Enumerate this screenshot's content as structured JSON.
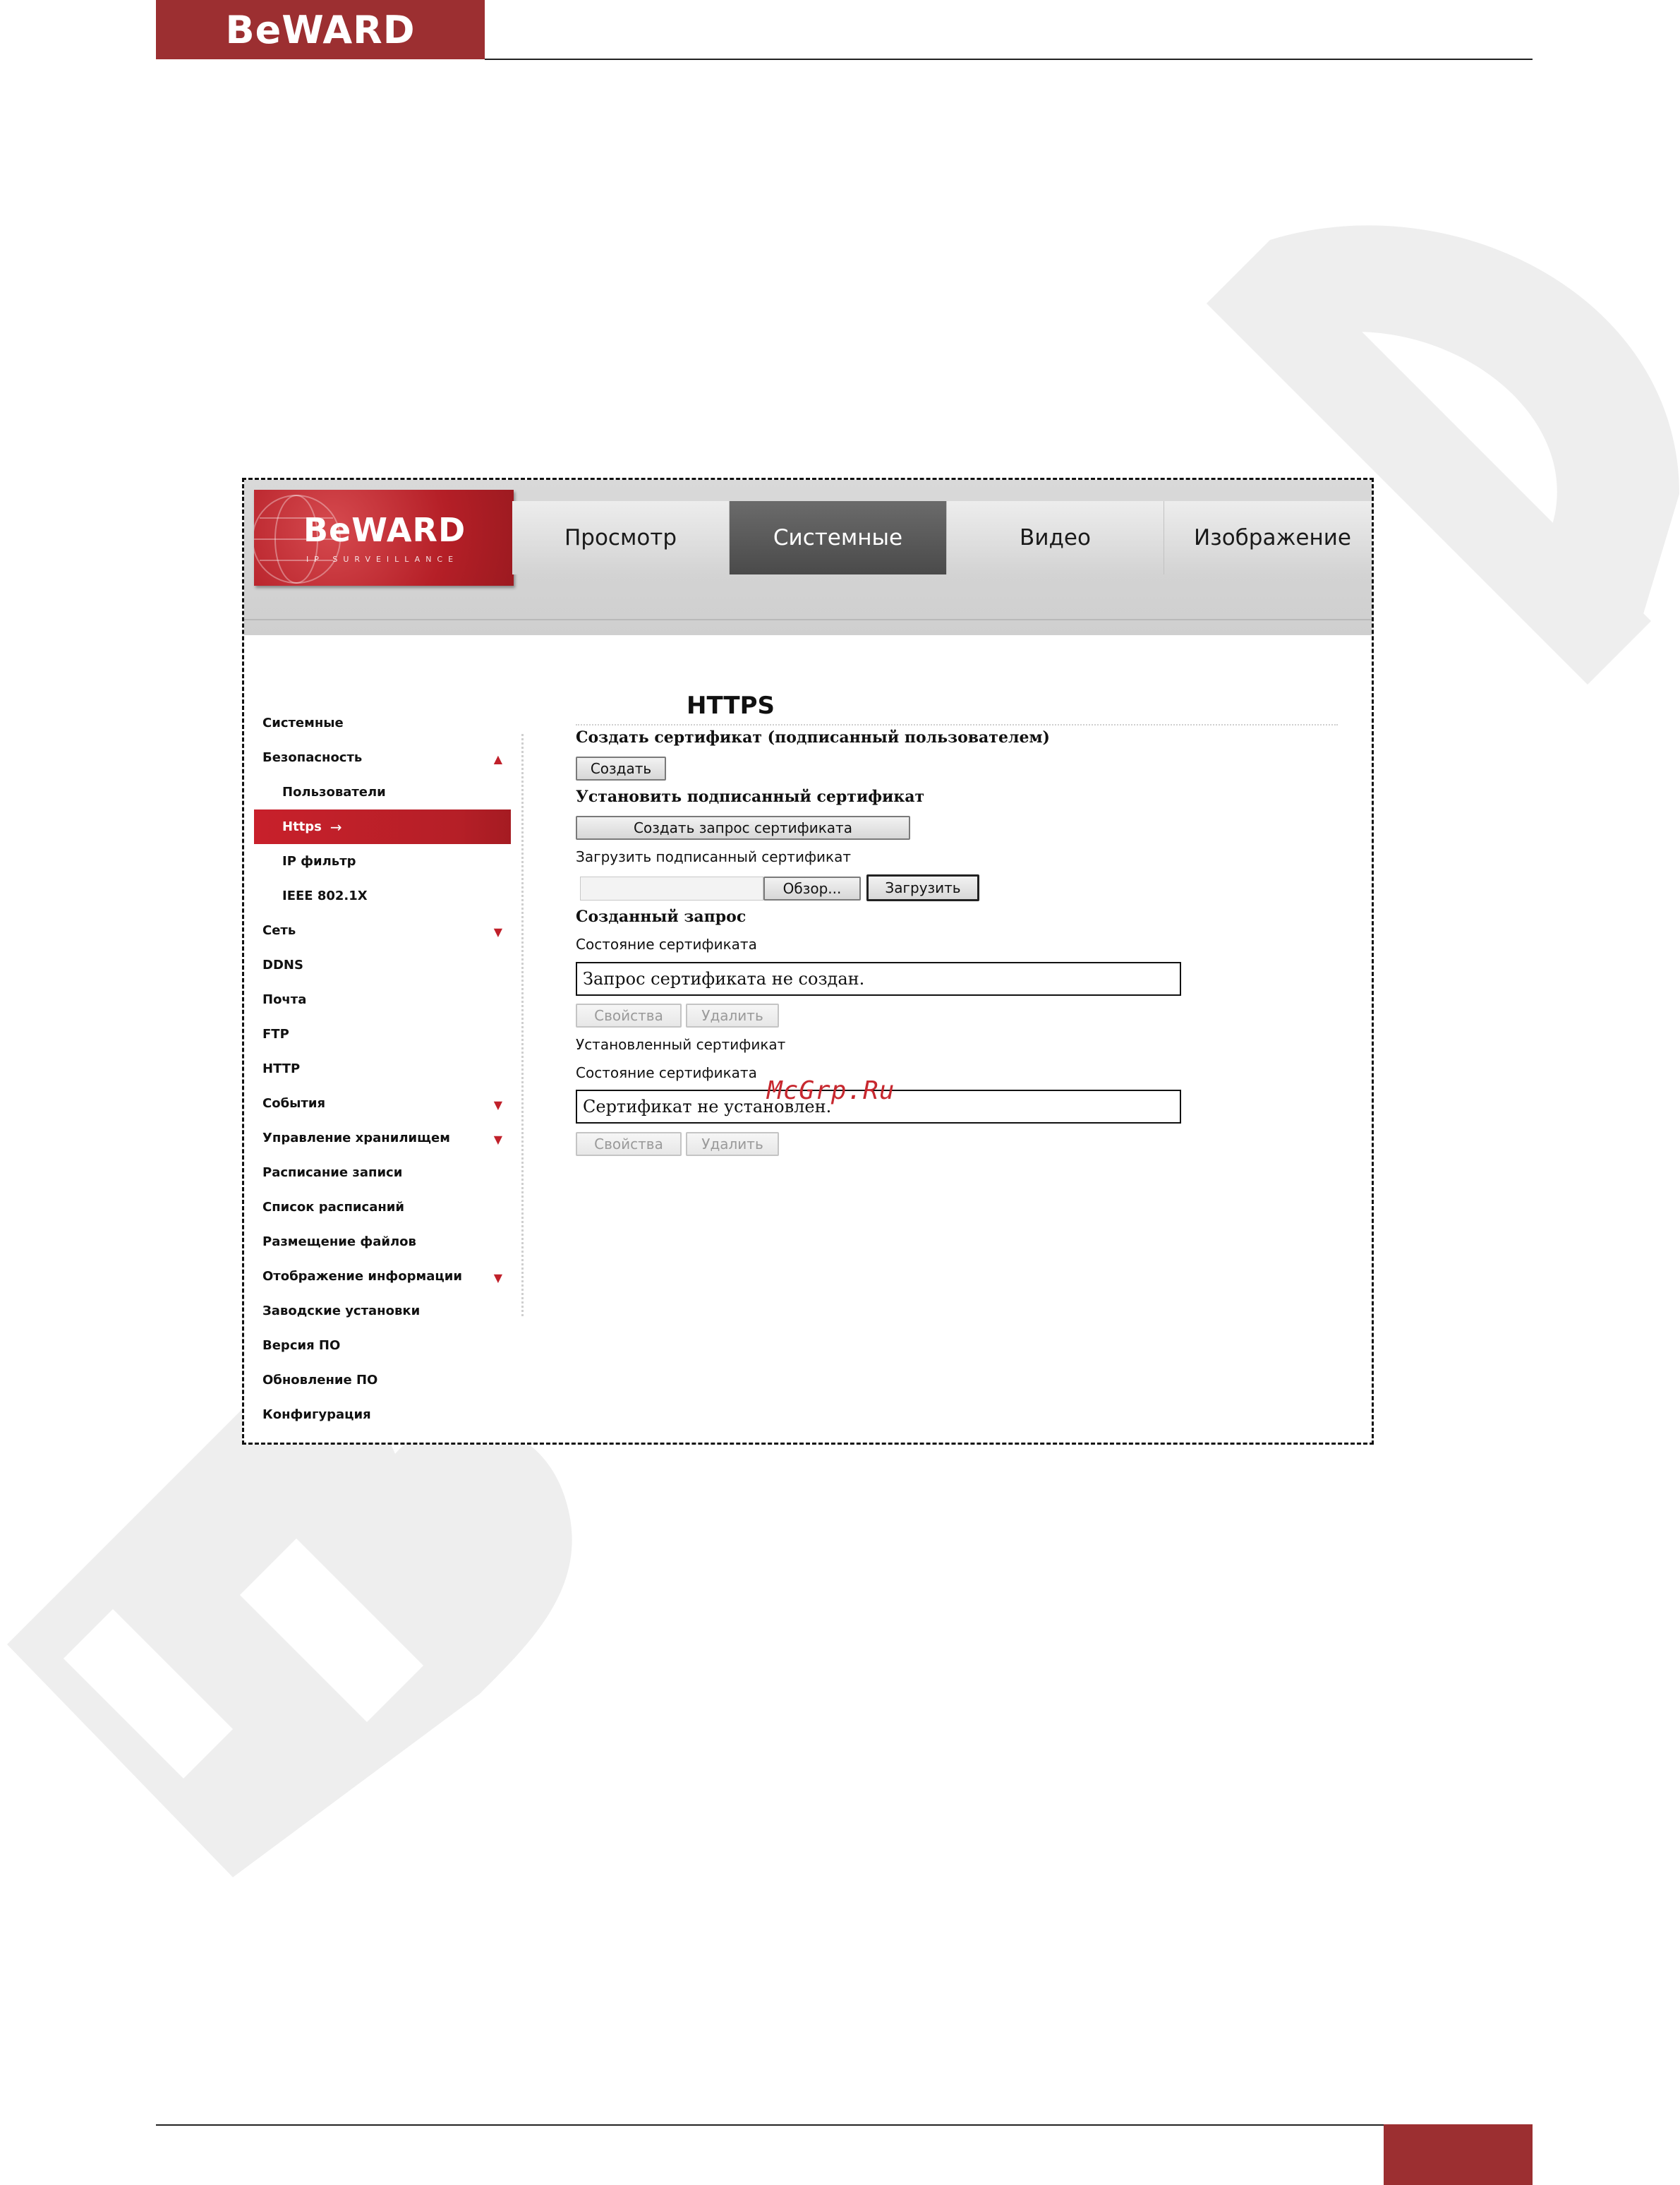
{
  "document": {
    "header_logo": "BeWARD",
    "watermark": "BeWARD"
  },
  "app": {
    "logo": {
      "brand": "BeWARD",
      "tagline": "IP SURVEILLANCE"
    },
    "tabs": [
      {
        "label": "Просмотр",
        "active": false
      },
      {
        "label": "Системные",
        "active": true
      },
      {
        "label": "Видео",
        "active": false
      },
      {
        "label": "Изображение",
        "active": false
      }
    ],
    "sidebar": {
      "items": [
        {
          "label": "Системные",
          "sub": false,
          "active": false,
          "arrow": ""
        },
        {
          "label": "Безопасность",
          "sub": false,
          "active": false,
          "arrow": "▲"
        },
        {
          "label": "Пользователи",
          "sub": true,
          "active": false,
          "arrow": ""
        },
        {
          "label": "Https",
          "sub": true,
          "active": true,
          "arrow": "",
          "pointer": "→"
        },
        {
          "label": "IP фильтр",
          "sub": true,
          "active": false,
          "arrow": ""
        },
        {
          "label": "IEEE 802.1X",
          "sub": true,
          "active": false,
          "arrow": ""
        },
        {
          "label": "Сеть",
          "sub": false,
          "active": false,
          "arrow": "▼"
        },
        {
          "label": "DDNS",
          "sub": false,
          "active": false,
          "arrow": ""
        },
        {
          "label": "Почта",
          "sub": false,
          "active": false,
          "arrow": ""
        },
        {
          "label": "FTP",
          "sub": false,
          "active": false,
          "arrow": ""
        },
        {
          "label": "HTTP",
          "sub": false,
          "active": false,
          "arrow": ""
        },
        {
          "label": "События",
          "sub": false,
          "active": false,
          "arrow": "▼"
        },
        {
          "label": "Управление хранилищем",
          "sub": false,
          "active": false,
          "arrow": "▼"
        },
        {
          "label": "Расписание записи",
          "sub": false,
          "active": false,
          "arrow": ""
        },
        {
          "label": "Список расписаний",
          "sub": false,
          "active": false,
          "arrow": ""
        },
        {
          "label": "Размещение файлов",
          "sub": false,
          "active": false,
          "arrow": ""
        },
        {
          "label": "Отображение информации",
          "sub": false,
          "active": false,
          "arrow": "▼"
        },
        {
          "label": "Заводские установки",
          "sub": false,
          "active": false,
          "arrow": ""
        },
        {
          "label": "Версия ПО",
          "sub": false,
          "active": false,
          "arrow": ""
        },
        {
          "label": "Обновление ПО",
          "sub": false,
          "active": false,
          "arrow": ""
        },
        {
          "label": "Конфигурация",
          "sub": false,
          "active": false,
          "arrow": ""
        }
      ]
    },
    "content": {
      "title": "HTTPS",
      "create_cert_heading": "Создать сертификат (подписанный пользователем)",
      "create_button": "Создать",
      "install_heading": "Установить подписанный сертификат",
      "request_button": "Создать запрос сертификата",
      "upload_label": "Загрузить подписанный сертификат",
      "browse_button": "Обзор...",
      "upload_button": "Загрузить",
      "created_request_heading": "Созданный запрос",
      "cert_state_label_1": "Состояние сертификата",
      "cert_state_value_1": "Запрос сертификата не создан.",
      "properties_button_1": "Свойства",
      "delete_button_1": "Удалить",
      "installed_cert_label": "Установленный сертификат",
      "cert_state_label_2": "Состояние сертификата",
      "cert_state_value_2": "Сертификат не установлен.",
      "properties_button_2": "Свойства",
      "delete_button_2": "Удалить"
    }
  },
  "overlay_text": "McGrp.Ru",
  "colors": {
    "brand_red": "#9c2f31",
    "active_tab": "#555555",
    "sidebar_active": "#b51f27"
  }
}
